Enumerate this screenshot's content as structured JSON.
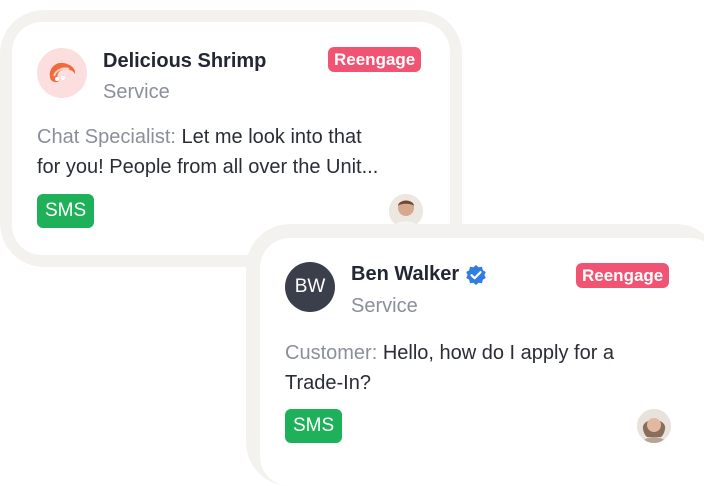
{
  "cards": [
    {
      "contact_name": "Delicious Shrimp",
      "department": "Service",
      "status_badge": "Reengage",
      "sender": "Chat Specialist:",
      "message_line1": "Let me look into that",
      "message_line2": "for you! People from all over the Unit...",
      "channel": "SMS",
      "avatar_icon": "shrimp-logo-icon",
      "agent_avatar_icon": "agent-photo-icon"
    },
    {
      "contact_name": "Ben Walker",
      "department": "Service",
      "status_badge": "Reengage",
      "sender": "Customer:",
      "message_line1": "Hello, how do I apply for a",
      "message_line2": "Trade-In?",
      "channel": "SMS",
      "avatar_initials": "BW",
      "verified_icon": "verified-badge-icon",
      "agent_avatar_icon": "agent-photo-icon"
    }
  ],
  "colors": {
    "badge": "#f05472",
    "channel": "#1fb05a",
    "verified": "#2f7de0",
    "initials_avatar": "#3a3f4b"
  }
}
